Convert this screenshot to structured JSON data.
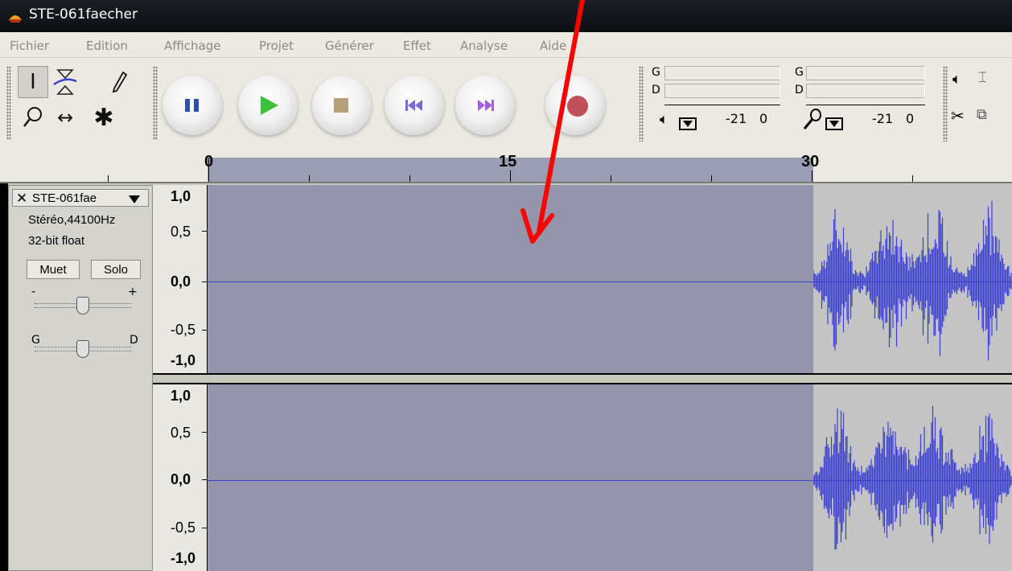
{
  "window": {
    "title": "STE-061faecher"
  },
  "menu": [
    "Fichier",
    "Edition",
    "Affichage",
    "Projet",
    "Générer",
    "Effet",
    "Analyse",
    "Aide"
  ],
  "meters": {
    "playback": {
      "left_label": "G",
      "right_label": "D",
      "scale_a": "-21",
      "scale_b": "0"
    },
    "record": {
      "left_label": "G",
      "right_label": "D",
      "scale_a": "-21",
      "scale_b": "0"
    }
  },
  "ruler": {
    "labels": [
      "0",
      "15",
      "30"
    ]
  },
  "track": {
    "name": "STE-061fae",
    "format": "Stéréo,44100Hz",
    "bit_depth": "32-bit float",
    "mute_label": "Muet",
    "solo_label": "Solo",
    "gain_minus": "-",
    "gain_plus": "+",
    "pan_left": "G",
    "pan_right": "D",
    "channel_scale": [
      "1,0",
      "0,5",
      "0,0",
      "-0,5",
      "-1,0"
    ]
  },
  "colors": {
    "selection": "#9494aa",
    "waveform": "#3a3fcf",
    "annotation_arrow": "#ff0000"
  }
}
